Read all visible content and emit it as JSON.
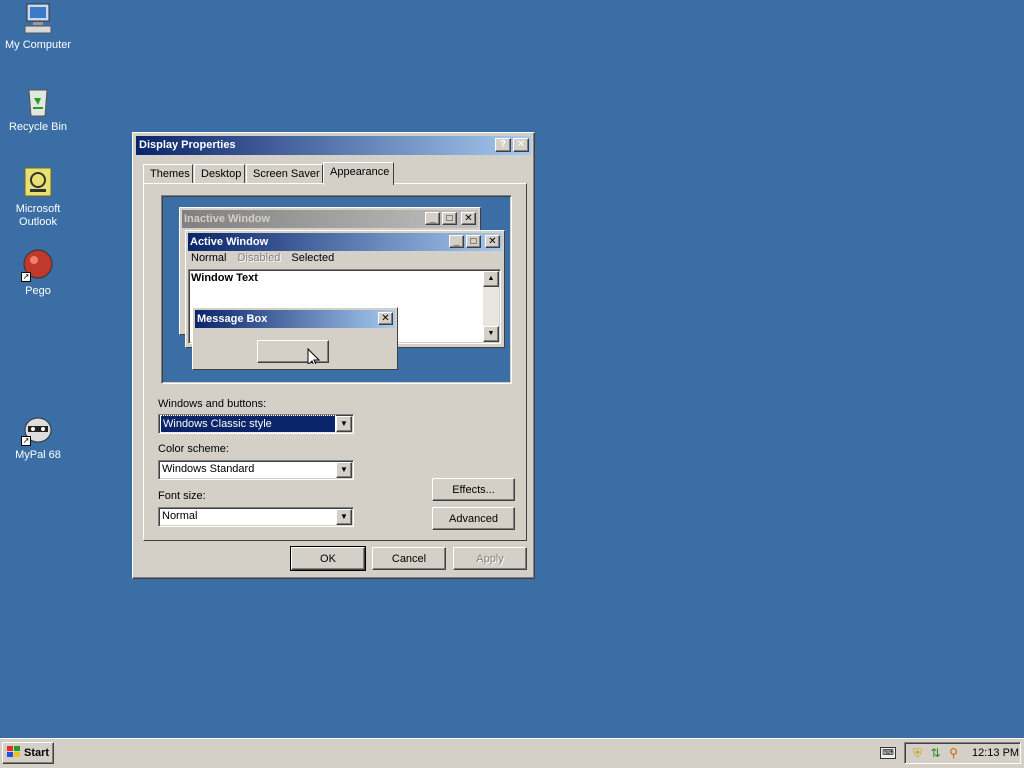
{
  "desktop": {
    "icons": [
      {
        "label": "My Computer",
        "icon": "computer-icon"
      },
      {
        "label": "Recycle Bin",
        "icon": "recycle-bin-icon"
      },
      {
        "label": "Microsoft\nOutlook",
        "icon": "outlook-icon"
      },
      {
        "label": "Pego",
        "icon": "pego-icon"
      },
      {
        "label": "MyPal 68",
        "icon": "mypal-icon"
      }
    ]
  },
  "dialog": {
    "title": "Display Properties",
    "help_glyph": "?",
    "close_glyph": "✕",
    "tabs": [
      {
        "label": "Themes",
        "active": false
      },
      {
        "label": "Desktop",
        "active": false
      },
      {
        "label": "Screen Saver",
        "active": false
      },
      {
        "label": "Appearance",
        "active": true
      }
    ],
    "preview": {
      "inactive_title": "Inactive Window",
      "active_title": "Active Window",
      "menu_items": [
        "Normal",
        "Disabled",
        "Selected"
      ],
      "window_text": "Window Text",
      "message_box_title": "Message Box"
    },
    "windows_buttons": {
      "label": "Windows and buttons:",
      "value": "Windows Classic style"
    },
    "color_scheme": {
      "label": "Color scheme:",
      "value": "Windows Standard"
    },
    "font_size": {
      "label": "Font size:",
      "value": "Normal"
    },
    "effects_button": "Effects...",
    "advanced_button": "Advanced",
    "ok_button": "OK",
    "cancel_button": "Cancel",
    "apply_button": "Apply"
  },
  "taskbar": {
    "start_label": "Start",
    "clock": "12:13 PM",
    "tray_icons": [
      "keyboard-icon",
      "shield-icon",
      "network-icon",
      "search-icon"
    ]
  },
  "colors": {
    "desktop": "#3a6ea5",
    "active_title_start": "#0a246a",
    "active_title_end": "#a6caf0",
    "inactive_title_start": "#808080",
    "inactive_title_end": "#c0c0c0",
    "face": "#d4d0c8"
  }
}
